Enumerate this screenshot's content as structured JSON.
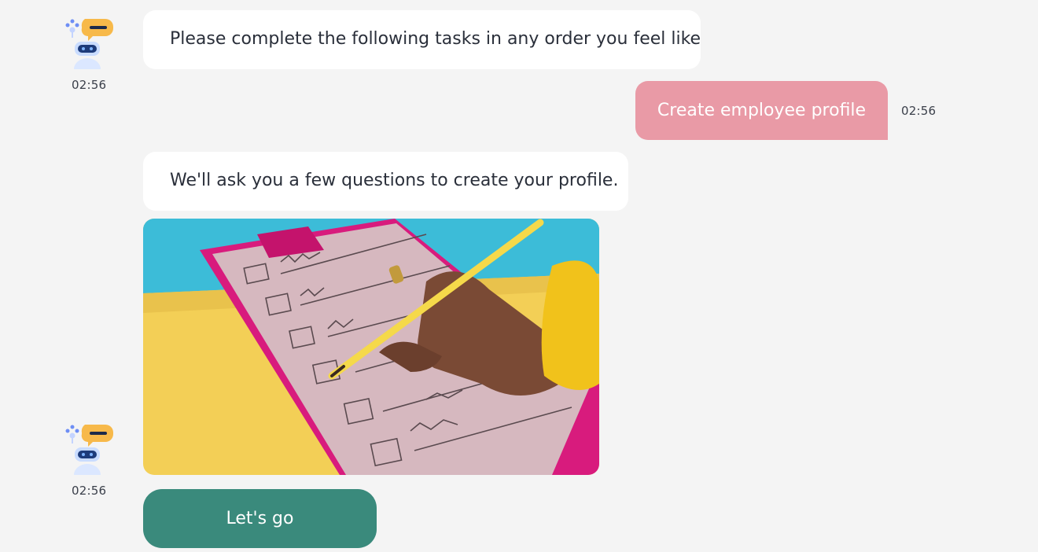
{
  "messages": {
    "bot_1": {
      "text": "Please complete the following tasks in any order you feel like",
      "time": "02:56"
    },
    "user_1": {
      "text": "Create employee profile",
      "time": "02:56"
    },
    "bot_2": {
      "text": "We'll ask you a few questions to create your profile.",
      "image": "clipboard-checklist-image",
      "time": "02:56"
    }
  },
  "actions": {
    "lets_go_label": "Let's go"
  },
  "colors": {
    "background": "#f4f4f4",
    "bot_bubble": "#ffffff",
    "user_bubble": "#e99aa6",
    "primary_button": "#3a8a7c"
  },
  "icons": {
    "bot_avatar": "robot-chat-avatar-icon"
  }
}
